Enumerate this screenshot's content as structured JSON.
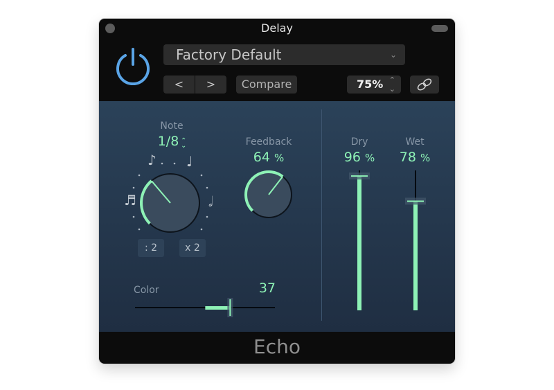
{
  "window": {
    "title": "Delay"
  },
  "header": {
    "preset": "Factory Default",
    "prev_label": "<",
    "next_label": ">",
    "compare_label": "Compare",
    "zoom_value": "75%"
  },
  "controls": {
    "note": {
      "label": "Note",
      "value": "1/8",
      "halve_label": ": 2",
      "double_label": "x 2",
      "fraction": 0.35
    },
    "feedback": {
      "label": "Feedback",
      "value": "64",
      "unit": "%",
      "fraction": 0.64
    },
    "dry": {
      "label": "Dry",
      "value": "96",
      "unit": "%",
      "fraction": 0.96
    },
    "wet": {
      "label": "Wet",
      "value": "78",
      "unit": "%",
      "fraction": 0.78
    },
    "color": {
      "label": "Color",
      "value": "37",
      "fraction": 0.68
    }
  },
  "footer": {
    "name": "Echo"
  },
  "colors": {
    "accent": "#8ef2b6",
    "power": "#5aa4e6"
  }
}
